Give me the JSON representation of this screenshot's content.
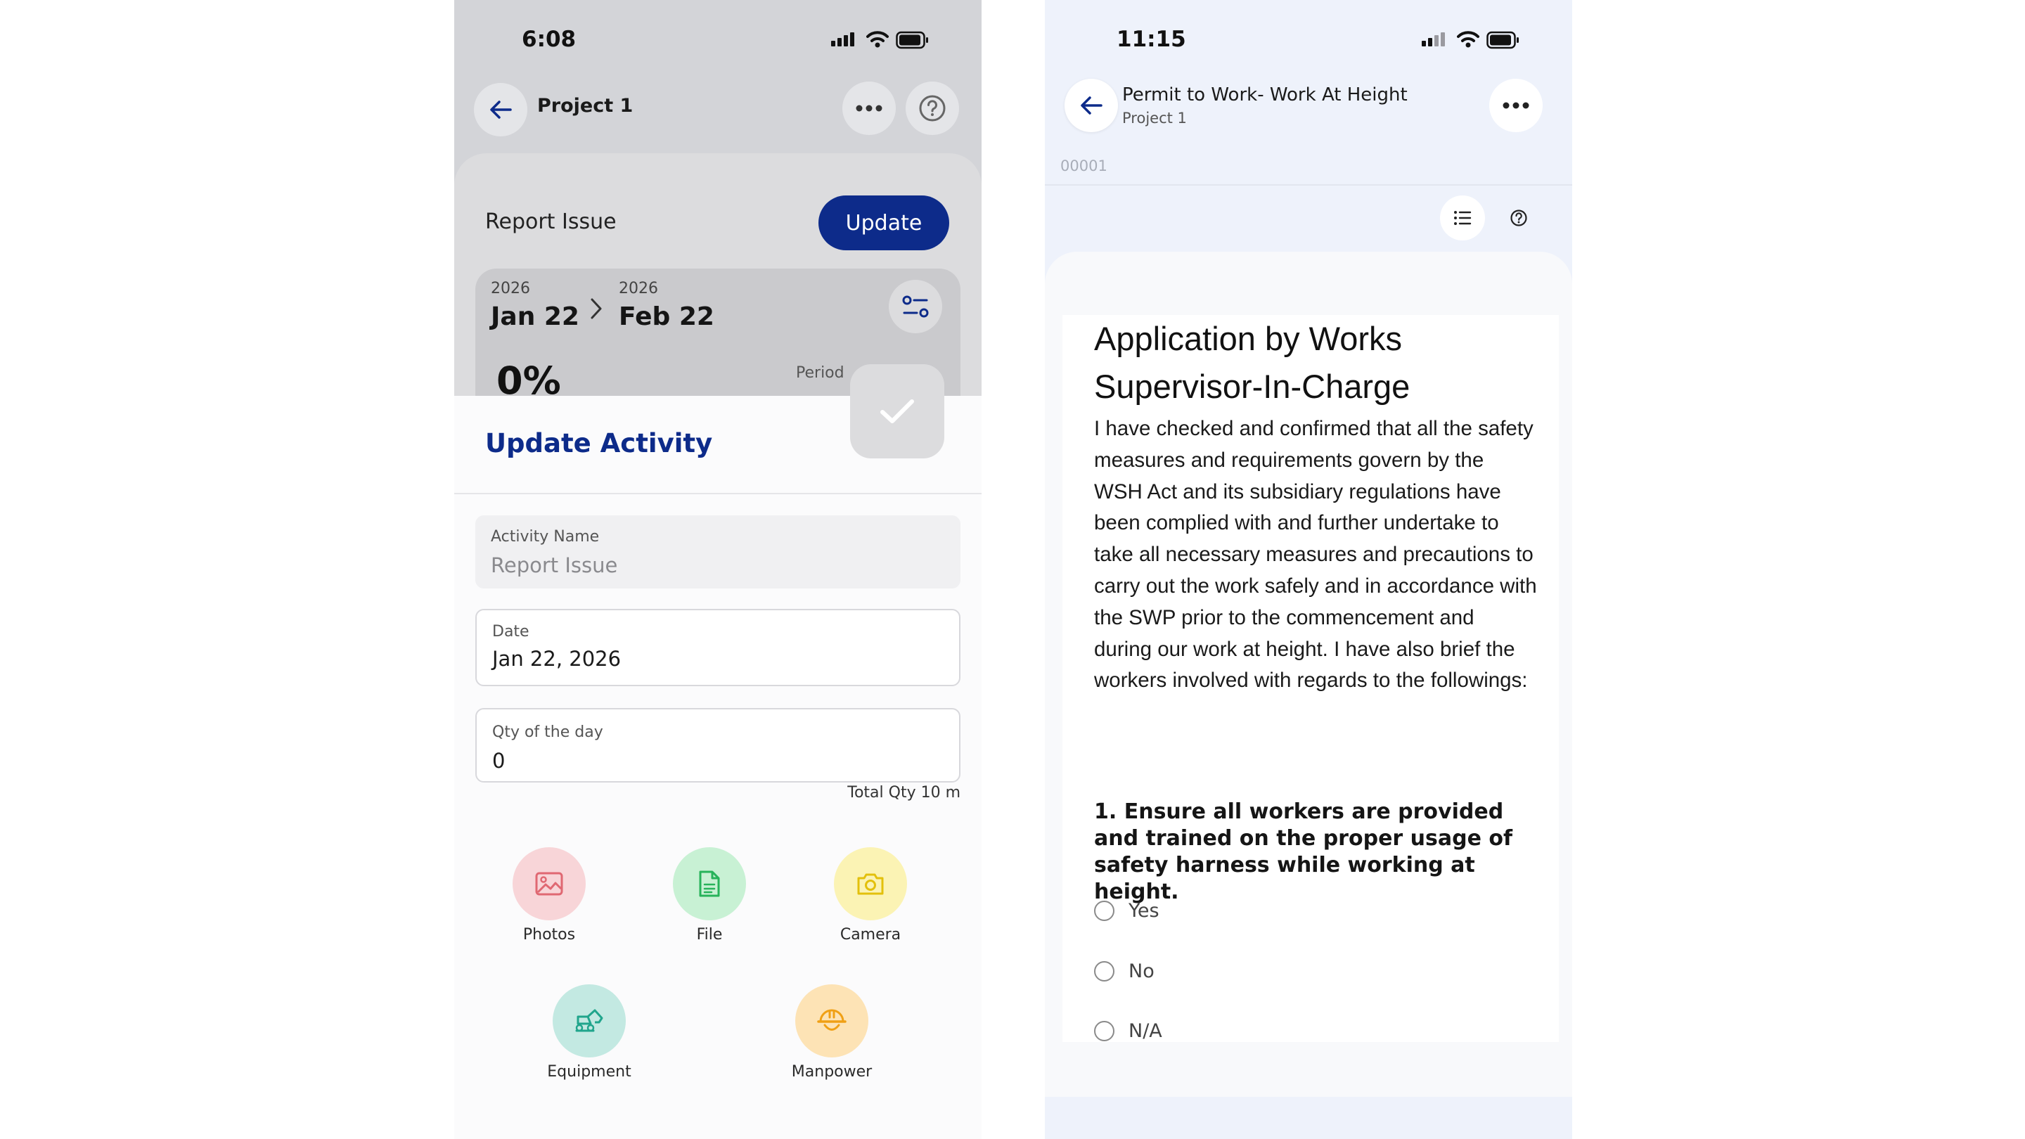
{
  "left_phone": {
    "status_time": "6:08",
    "header_title": "Project 1",
    "report_issue_title": "Report Issue",
    "update_button": "Update",
    "start": {
      "year": "2026",
      "date": "Jan 22"
    },
    "end": {
      "year": "2026",
      "date": "Feb 22"
    },
    "progress_percent": "0%",
    "period_label": "Period",
    "sheet_title": "Update Activity",
    "activity_name": {
      "label": "Activity Name",
      "value": "Report Issue"
    },
    "date_field": {
      "label": "Date",
      "value": "Jan 22, 2026"
    },
    "qty_field": {
      "label": "Qty of the day",
      "value": "0"
    },
    "total_qty": "Total Qty 10 m",
    "attachments": [
      {
        "label": "Photos",
        "icon": "image-icon",
        "bg": "#f8d5d8",
        "color": "#e06872"
      },
      {
        "label": "File",
        "icon": "file-icon",
        "bg": "#c8f1d4",
        "color": "#27b35a"
      },
      {
        "label": "Camera",
        "icon": "camera-icon",
        "bg": "#fbf3b4",
        "color": "#e3c00c"
      },
      {
        "label": "Equipment",
        "icon": "excavator-icon",
        "bg": "#c3e9e2",
        "color": "#20a58c"
      },
      {
        "label": "Manpower",
        "icon": "helmet-icon",
        "bg": "#fde3b5",
        "color": "#f0a015"
      }
    ],
    "colors": {
      "primary": "#0d2b8a",
      "overlay": "#d3d4d8"
    }
  },
  "right_phone": {
    "status_time": "11:15",
    "header_title": "Permit to Work- Work At Height",
    "header_subtitle": "Project 1",
    "doc_number": "00001",
    "heading": "Application by Works Supervisor-In-Charge",
    "paragraph": "I have checked and confirmed that all the safety measures and requirements govern by the WSH Act and its subsidiary regulations have been complied with and further undertake to take all necessary measures and precautions to carry out the work safely and in accordance with the SWP prior to the commencement and during our work at height. I have also brief the workers involved with regards to the followings:",
    "question": "1. Ensure all workers are provided and trained on the proper usage of safety harness while working at height.",
    "options": [
      "Yes",
      "No",
      "N/A"
    ],
    "colors": {
      "background": "#eef2fb",
      "primary": "#0d2b8a"
    }
  }
}
